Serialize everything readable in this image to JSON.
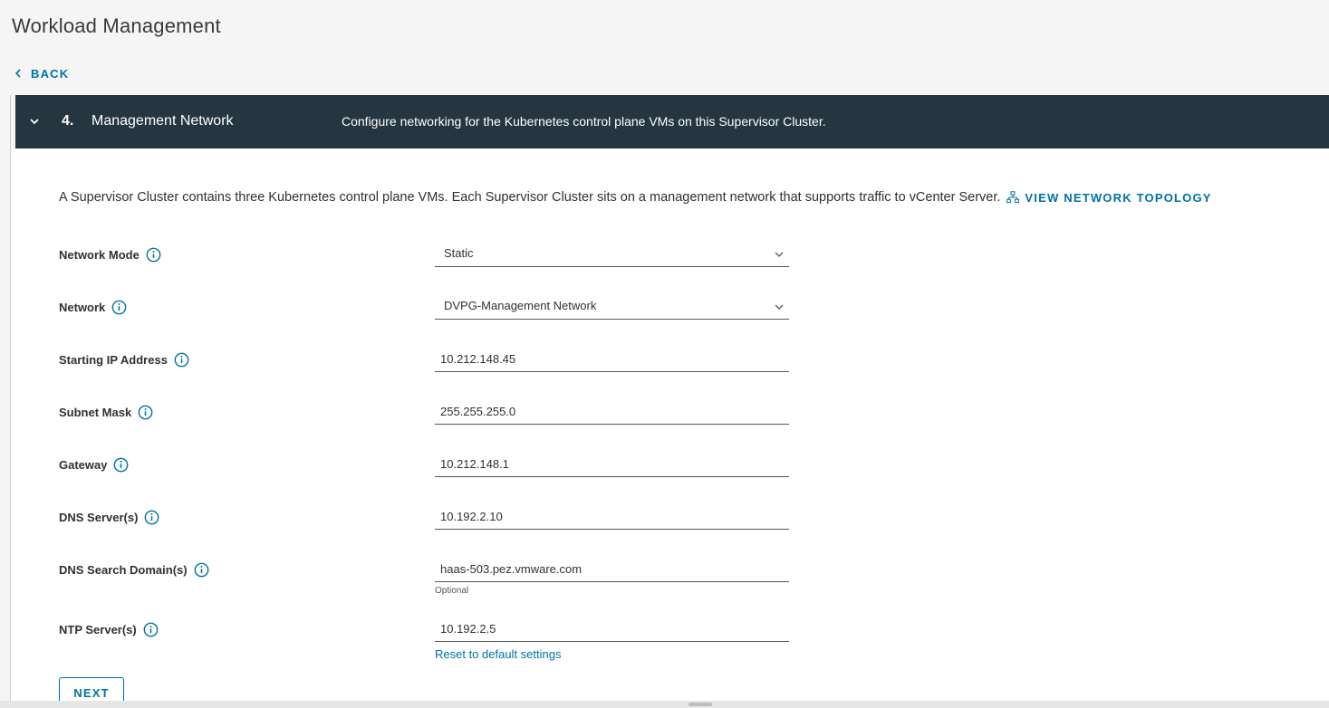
{
  "page": {
    "title": "Workload Management"
  },
  "nav": {
    "back_label": "BACK"
  },
  "step": {
    "number": "4.",
    "title": "Management Network",
    "description": "Configure networking for the Kubernetes control plane VMs on this Supervisor Cluster."
  },
  "intro": {
    "text": "A Supervisor Cluster contains three Kubernetes control plane VMs. Each Supervisor Cluster sits on a management network that supports traffic to vCenter Server.",
    "topology_link": "VIEW NETWORK TOPOLOGY"
  },
  "form": {
    "network_mode": {
      "label": "Network Mode",
      "value": "Static"
    },
    "network": {
      "label": "Network",
      "value": "DVPG-Management Network"
    },
    "starting_ip": {
      "label": "Starting IP Address",
      "value": "10.212.148.45"
    },
    "subnet_mask": {
      "label": "Subnet Mask",
      "value": "255.255.255.0"
    },
    "gateway": {
      "label": "Gateway",
      "value": "10.212.148.1"
    },
    "dns_servers": {
      "label": "DNS Server(s)",
      "value": "10.192.2.10"
    },
    "dns_search": {
      "label": "DNS Search Domain(s)",
      "value": "haas-503.pez.vmware.com",
      "helper": "Optional"
    },
    "ntp_servers": {
      "label": "NTP Server(s)",
      "value": "10.192.2.5",
      "reset_link": "Reset to default settings"
    }
  },
  "actions": {
    "next_label": "NEXT"
  },
  "colors": {
    "accent": "#0072a3",
    "header_bg": "#253640",
    "background": "#f5f5f5"
  },
  "icons": [
    "chevron-left-icon",
    "chevron-down-icon",
    "network-topology-icon",
    "info-circle-icon"
  ]
}
